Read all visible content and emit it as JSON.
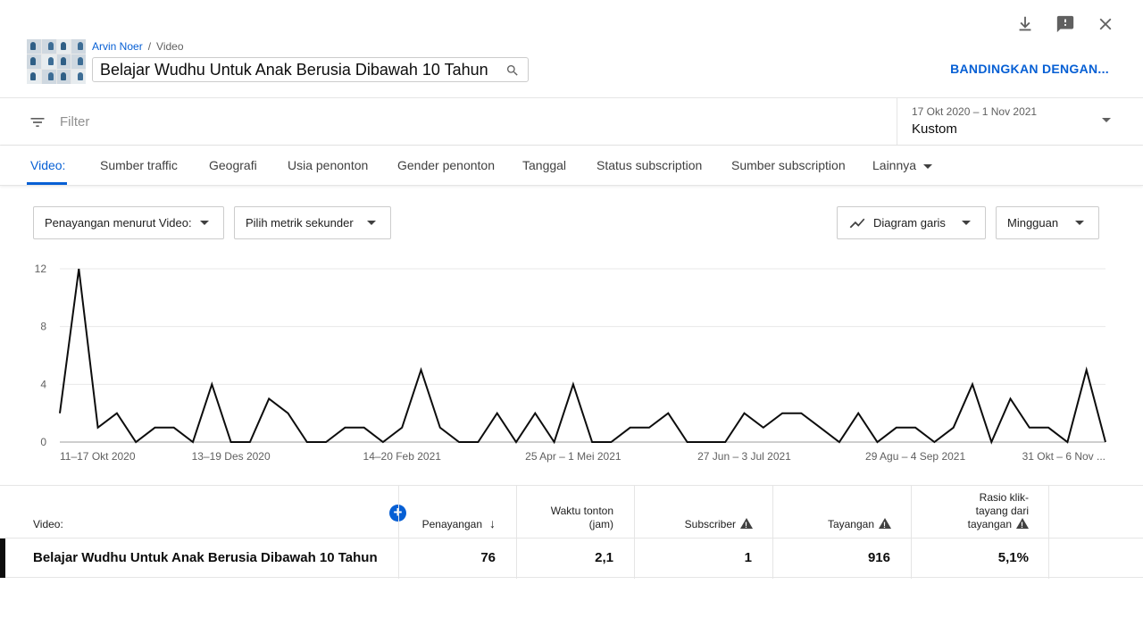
{
  "header": {
    "channel_name": "Arvin Noer",
    "breadcrumb_separator": "/",
    "breadcrumb_section": "Video",
    "video_title": "Belajar Wudhu Untuk Anak Berusia Dibawah 10 Tahun",
    "compare_label": "BANDINGKAN DENGAN..."
  },
  "top_actions": [
    "download-icon",
    "feedback-icon",
    "close-icon"
  ],
  "filter": {
    "placeholder": "Filter",
    "date_range": "17 Okt 2020 – 1 Nov 2021",
    "date_preset": "Kustom"
  },
  "tabs": [
    {
      "label": "Video:",
      "active": true
    },
    {
      "label": "Sumber traffic"
    },
    {
      "label": "Geografi"
    },
    {
      "label": "Usia penonton"
    },
    {
      "label": "Gender penonton"
    },
    {
      "label": "Tanggal"
    },
    {
      "label": "Status subscription"
    },
    {
      "label": "Sumber subscription"
    },
    {
      "label": "Lainnya"
    }
  ],
  "controls": {
    "primary_metric": "Penayangan menurut Video:",
    "secondary_metric": "Pilih metrik sekunder",
    "chart_type": "Diagram garis",
    "interval": "Mingguan"
  },
  "chart_data": {
    "type": "line",
    "x_tick_labels": [
      "11–17 Okt 2020",
      "13–19 Des 2020",
      "14–20 Feb 2021",
      "25 Apr – 1 Mei 2021",
      "27 Jun – 3 Jul 2021",
      "29 Agu – 4 Sep 2021",
      "31 Okt – 6 Nov ..."
    ],
    "y_ticks": [
      0,
      4,
      8,
      12
    ],
    "ylim": [
      0,
      12
    ],
    "grid": true,
    "series": [
      {
        "values": [
          2,
          12,
          1,
          2,
          0,
          1,
          1,
          0,
          4,
          0,
          0,
          3,
          2,
          0,
          0,
          1,
          1,
          0,
          1,
          5,
          1,
          0,
          0,
          2,
          0,
          2,
          0,
          4,
          0,
          0,
          1,
          1,
          2,
          0,
          0,
          0,
          2,
          1,
          2,
          2,
          1,
          0,
          2,
          0,
          1,
          1,
          0,
          1,
          4,
          0,
          3,
          1,
          1,
          0,
          5,
          0
        ]
      }
    ]
  },
  "table": {
    "columns": [
      {
        "label": "Video:"
      },
      {
        "label": "Penayangan"
      },
      {
        "label": "Waktu tonton (jam)"
      },
      {
        "label": "Subscriber"
      },
      {
        "label": "Tayangan"
      },
      {
        "label": "Rasio klik-tayang dari tayangan"
      }
    ],
    "rows": [
      {
        "video": "Belajar Wudhu Untuk Anak Berusia Dibawah 10 Tahun",
        "penayangan": "76",
        "waktu_tonton": "2,1",
        "subscriber": "1",
        "tayangan": "916",
        "ctr": "5,1%"
      }
    ]
  }
}
